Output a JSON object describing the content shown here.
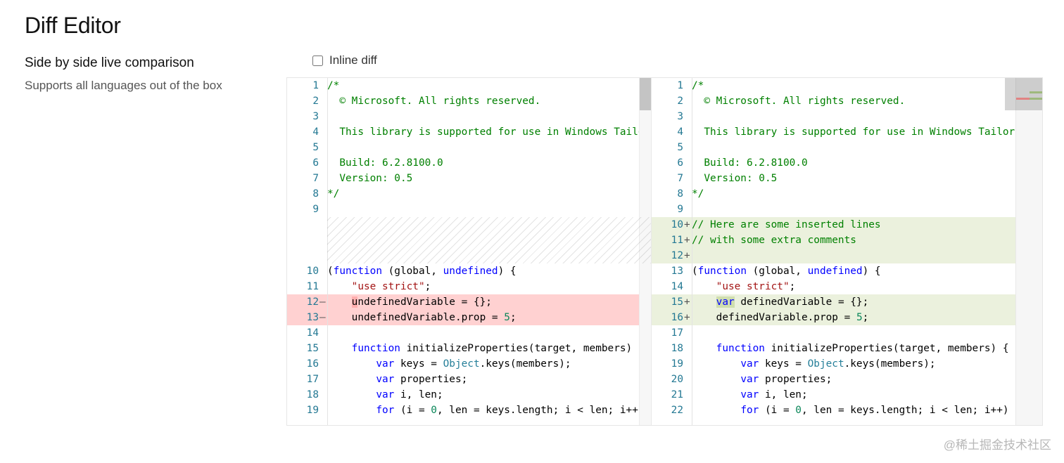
{
  "page": {
    "title": "Diff Editor",
    "section_title": "Side by side live comparison",
    "section_subtitle": "Supports all languages out of the box",
    "inline_toggle_label": "Inline diff",
    "inline_toggle_checked": false
  },
  "editor": {
    "deletion_marker": "—",
    "insertion_marker": "+",
    "original_lines": [
      {
        "n": "1",
        "row": "",
        "mark": "",
        "tokens": [
          [
            "c",
            "/*"
          ]
        ]
      },
      {
        "n": "2",
        "row": "",
        "mark": "",
        "tokens": [
          [
            "c",
            "  © Microsoft. All rights reserved."
          ]
        ]
      },
      {
        "n": "3",
        "row": "",
        "mark": "",
        "tokens": []
      },
      {
        "n": "4",
        "row": "",
        "mark": "",
        "tokens": [
          [
            "c",
            "  This library is supported for use in Windows Tailored Apps only."
          ]
        ]
      },
      {
        "n": "5",
        "row": "",
        "mark": "",
        "tokens": []
      },
      {
        "n": "6",
        "row": "",
        "mark": "",
        "tokens": [
          [
            "c",
            "  Build: 6.2.8100.0"
          ]
        ]
      },
      {
        "n": "7",
        "row": "",
        "mark": "",
        "tokens": [
          [
            "c",
            "  Version: 0.5"
          ]
        ]
      },
      {
        "n": "8",
        "row": "",
        "mark": "",
        "tokens": [
          [
            "c",
            "*/"
          ]
        ]
      },
      {
        "n": "9",
        "row": "",
        "mark": "",
        "tokens": []
      },
      {
        "filler": 3
      },
      {
        "n": "10",
        "row": "",
        "mark": "",
        "tokens": [
          [
            "p",
            "("
          ],
          [
            "k",
            "function"
          ],
          [
            "p",
            " (global, "
          ],
          [
            "k",
            "undefined"
          ],
          [
            "p",
            ") {"
          ]
        ]
      },
      {
        "n": "11",
        "row": "",
        "mark": "",
        "tokens": [
          [
            "p",
            "    "
          ],
          [
            "s",
            "\"use strict\""
          ],
          [
            "p",
            ";"
          ]
        ]
      },
      {
        "n": "12",
        "row": "del",
        "mark": "del",
        "tokens": [
          [
            "p",
            "    "
          ],
          [
            "x",
            "u"
          ],
          [
            "p",
            "ndefinedVariable = {};"
          ]
        ]
      },
      {
        "n": "13",
        "row": "del",
        "mark": "del",
        "tokens": [
          [
            "p",
            "    undefinedVariable.prop = "
          ],
          [
            "m",
            "5"
          ],
          [
            "p",
            ";"
          ]
        ]
      },
      {
        "n": "14",
        "row": "",
        "mark": "",
        "tokens": []
      },
      {
        "n": "15",
        "row": "",
        "mark": "",
        "tokens": [
          [
            "p",
            "    "
          ],
          [
            "k",
            "function"
          ],
          [
            "p",
            " initializeProperties(target, members) {"
          ]
        ]
      },
      {
        "n": "16",
        "row": "",
        "mark": "",
        "tokens": [
          [
            "p",
            "        "
          ],
          [
            "k",
            "var"
          ],
          [
            "p",
            " keys = "
          ],
          [
            "t",
            "Object"
          ],
          [
            "p",
            ".keys(members);"
          ]
        ]
      },
      {
        "n": "17",
        "row": "",
        "mark": "",
        "tokens": [
          [
            "p",
            "        "
          ],
          [
            "k",
            "var"
          ],
          [
            "p",
            " properties;"
          ]
        ]
      },
      {
        "n": "18",
        "row": "",
        "mark": "",
        "tokens": [
          [
            "p",
            "        "
          ],
          [
            "k",
            "var"
          ],
          [
            "p",
            " i, len;"
          ]
        ]
      },
      {
        "n": "19",
        "row": "",
        "mark": "",
        "tokens": [
          [
            "p",
            "        "
          ],
          [
            "k",
            "for"
          ],
          [
            "p",
            " (i = "
          ],
          [
            "m",
            "0"
          ],
          [
            "p",
            ", len = keys.length; i < len; i++) {"
          ]
        ]
      }
    ],
    "modified_lines": [
      {
        "n": "1",
        "row": "",
        "mark": "",
        "tokens": [
          [
            "c",
            "/*"
          ]
        ]
      },
      {
        "n": "2",
        "row": "",
        "mark": "",
        "tokens": [
          [
            "c",
            "  © Microsoft. All rights reserved."
          ]
        ]
      },
      {
        "n": "3",
        "row": "",
        "mark": "",
        "tokens": []
      },
      {
        "n": "4",
        "row": "",
        "mark": "",
        "tokens": [
          [
            "c",
            "  This library is supported for use in Windows Tailored Apps only."
          ]
        ]
      },
      {
        "n": "5",
        "row": "",
        "mark": "",
        "tokens": []
      },
      {
        "n": "6",
        "row": "",
        "mark": "",
        "tokens": [
          [
            "c",
            "  Build: 6.2.8100.0"
          ]
        ]
      },
      {
        "n": "7",
        "row": "",
        "mark": "",
        "tokens": [
          [
            "c",
            "  Version: 0.5"
          ]
        ]
      },
      {
        "n": "8",
        "row": "",
        "mark": "",
        "tokens": [
          [
            "c",
            "*/"
          ]
        ]
      },
      {
        "n": "9",
        "row": "",
        "mark": "",
        "tokens": []
      },
      {
        "n": "10",
        "row": "ins",
        "mark": "ins",
        "tokens": [
          [
            "c",
            "// Here are some inserted lines"
          ]
        ]
      },
      {
        "n": "11",
        "row": "ins",
        "mark": "ins",
        "tokens": [
          [
            "c",
            "// with some extra comments"
          ]
        ]
      },
      {
        "n": "12",
        "row": "ins",
        "mark": "ins",
        "tokens": []
      },
      {
        "n": "13",
        "row": "",
        "mark": "",
        "tokens": [
          [
            "p",
            "("
          ],
          [
            "k",
            "function"
          ],
          [
            "p",
            " (global, "
          ],
          [
            "k",
            "undefined"
          ],
          [
            "p",
            ") {"
          ]
        ]
      },
      {
        "n": "14",
        "row": "",
        "mark": "",
        "tokens": [
          [
            "p",
            "    "
          ],
          [
            "s",
            "\"use strict\""
          ],
          [
            "p",
            ";"
          ]
        ]
      },
      {
        "n": "15",
        "row": "ins",
        "mark": "ins",
        "tokens": [
          [
            "p",
            "    "
          ],
          [
            "y",
            "var"
          ],
          [
            "p",
            " definedVariable = {};"
          ]
        ]
      },
      {
        "n": "16",
        "row": "ins",
        "mark": "ins",
        "tokens": [
          [
            "p",
            "    definedVariable.prop = "
          ],
          [
            "m",
            "5"
          ],
          [
            "p",
            ";"
          ]
        ]
      },
      {
        "n": "17",
        "row": "",
        "mark": "",
        "tokens": []
      },
      {
        "n": "18",
        "row": "",
        "mark": "",
        "tokens": [
          [
            "p",
            "    "
          ],
          [
            "k",
            "function"
          ],
          [
            "p",
            " initializeProperties(target, members) {"
          ]
        ]
      },
      {
        "n": "19",
        "row": "",
        "mark": "",
        "tokens": [
          [
            "p",
            "        "
          ],
          [
            "k",
            "var"
          ],
          [
            "p",
            " keys = "
          ],
          [
            "t",
            "Object"
          ],
          [
            "p",
            ".keys(members);"
          ]
        ]
      },
      {
        "n": "20",
        "row": "",
        "mark": "",
        "tokens": [
          [
            "p",
            "        "
          ],
          [
            "k",
            "var"
          ],
          [
            "p",
            " properties;"
          ]
        ]
      },
      {
        "n": "21",
        "row": "",
        "mark": "",
        "tokens": [
          [
            "p",
            "        "
          ],
          [
            "k",
            "var"
          ],
          [
            "p",
            " i, len;"
          ]
        ]
      },
      {
        "n": "22",
        "row": "",
        "mark": "",
        "tokens": [
          [
            "p",
            "        "
          ],
          [
            "k",
            "for"
          ],
          [
            "p",
            " (i = "
          ],
          [
            "m",
            "0"
          ],
          [
            "p",
            ", len = keys.length; i < len; i++) {"
          ]
        ]
      }
    ]
  },
  "watermark": "@稀土掘金技术社区",
  "colors": {
    "comment": "#008000",
    "keyword": "#0000ff",
    "string": "#a31515",
    "number": "#098658",
    "type": "#267f99",
    "line_number": "#237893",
    "deleted_bg": "#fbd3d3",
    "inserted_bg": "#e6efd9"
  }
}
